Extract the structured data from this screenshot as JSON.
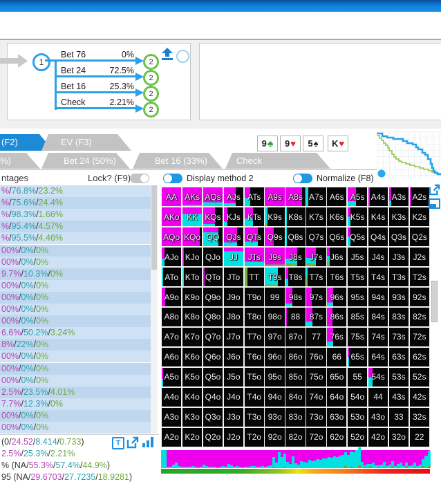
{
  "tree": {
    "root_node": "1",
    "branches": [
      {
        "label": "Bet 76",
        "freq": "0%",
        "node": "2"
      },
      {
        "label": "Bet 24",
        "freq": "72.5%",
        "node": "2"
      },
      {
        "label": "Bet 16",
        "freq": "25.3%",
        "node": "2"
      },
      {
        "label": "Check",
        "freq": "2.21%",
        "node": "2"
      }
    ]
  },
  "tabs_row1": [
    {
      "label": "(F2)",
      "active": true
    },
    {
      "label": "EV (F3)",
      "active": false
    }
  ],
  "tabs_row2": [
    {
      "label": "%)"
    },
    {
      "label": "Bet 24 (50%)"
    },
    {
      "label": "Bet 16 (33%)"
    },
    {
      "label": "Check"
    }
  ],
  "board_cards": [
    {
      "rank": "9",
      "suit": "♣",
      "color": "#2f9e2f",
      "gap_before": false
    },
    {
      "rank": "9",
      "suit": "♥",
      "color": "#e02828",
      "gap_before": false
    },
    {
      "rank": "5",
      "suit": "♠",
      "color": "#222222",
      "gap_before": false
    },
    {
      "rank": "K",
      "suit": "♥",
      "color": "#e02828",
      "gap_before": true
    }
  ],
  "left_panel": {
    "header": "ntages",
    "lock_label": "Lock? (F9)",
    "rows": [
      [
        "%",
        "76.8%",
        "23.2%"
      ],
      [
        "%",
        "75.6%",
        "24.4%"
      ],
      [
        "%",
        "98.3%",
        "1.66%"
      ],
      [
        "%",
        "95.4%",
        "4.57%"
      ],
      [
        "%",
        "95.5%",
        "4.46%"
      ],
      [
        "00%",
        "0%",
        "0%"
      ],
      [
        "00%",
        "0%",
        "0%"
      ],
      [
        "9.7%",
        "10.3%",
        "0%"
      ],
      [
        "00%",
        "0%",
        "0%"
      ],
      [
        "00%",
        "0%",
        "0%"
      ],
      [
        "00%",
        "0%",
        "0%"
      ],
      [
        "00%",
        "0%",
        "0%"
      ],
      [
        "6.6%",
        "50.2%",
        "3.24%"
      ],
      [
        "8%",
        "22%",
        "0%"
      ],
      [
        "00%",
        "0%",
        "0%"
      ],
      [
        "00%",
        "0%",
        "0%"
      ],
      [
        "00%",
        "0%",
        "0%"
      ],
      [
        "2.5%",
        "23.5%",
        "4.01%"
      ],
      [
        "7.7%",
        "12.3%",
        "0%"
      ],
      [
        "00%",
        "0%",
        "0%"
      ],
      [
        "00%",
        "0%",
        "0%"
      ]
    ]
  },
  "stats": {
    "lines": [
      [
        [
          "(0/",
          "d"
        ],
        [
          "24.52",
          "m"
        ],
        [
          "/",
          "d"
        ],
        [
          "8.414",
          "t"
        ],
        [
          "/",
          "d"
        ],
        [
          "0.733",
          "g"
        ],
        [
          ")",
          "d"
        ]
      ],
      [
        [
          "2.5%",
          "m"
        ],
        [
          "/",
          "d"
        ],
        [
          "25.3%",
          "t"
        ],
        [
          "/",
          "d"
        ],
        [
          "2.21%",
          "g"
        ]
      ],
      [
        [
          "% (NA/",
          "d"
        ],
        [
          "55.3%",
          "m"
        ],
        [
          "/",
          "d"
        ],
        [
          "57.4%",
          "t"
        ],
        [
          "/",
          "d"
        ],
        [
          "44.9%",
          "g"
        ],
        [
          ")",
          "d"
        ]
      ],
      [
        [
          "95 (NA/",
          "d"
        ],
        [
          "29.6703",
          "m"
        ],
        [
          "/",
          "d"
        ],
        [
          "27.7235",
          "t"
        ],
        [
          "/",
          "d"
        ],
        [
          "18.9281",
          "g"
        ],
        [
          ")",
          "d"
        ]
      ]
    ],
    "t_button": "T"
  },
  "toggles": {
    "display_method": "Display method 2",
    "normalize": "Normalize (F8)"
  },
  "matrix": {
    "ranks": [
      "A",
      "K",
      "Q",
      "J",
      "T",
      "9",
      "8",
      "7",
      "6",
      "5",
      "4",
      "3",
      "2"
    ],
    "action_colors": {
      "magenta": "#ee00ee",
      "cyan": "#00e2e2",
      "green": "#76b043",
      "none": "#060606"
    },
    "cells": [
      [
        [
          1,
          1,
          0,
          0
        ],
        [
          1,
          0.95,
          0.05,
          0
        ],
        [
          1,
          0.8,
          0.2,
          0
        ],
        [
          0.6,
          0.85,
          0.15,
          0
        ],
        [
          0.3,
          0.55,
          0.45,
          0
        ],
        [
          1,
          1,
          0,
          0
        ],
        [
          0.85,
          1,
          0,
          0
        ],
        [
          0.1,
          0,
          1,
          0
        ],
        [
          0
        ],
        [
          0.42,
          0.75,
          0.25,
          0
        ],
        [
          0.08,
          1,
          0,
          0
        ],
        [
          0.1,
          0.7,
          0.3,
          0
        ],
        [
          0.08,
          1,
          0,
          0
        ]
      ],
      [
        [
          1,
          1,
          0,
          0
        ],
        [
          1,
          0.35,
          0.65,
          0
        ],
        [
          0.62,
          0.88,
          0.12,
          0
        ],
        [
          0.2,
          0.75,
          0.25,
          0
        ],
        [
          0.45,
          0.6,
          0.4,
          0
        ],
        [
          0.12,
          0,
          0.85,
          0.15
        ],
        [
          0.06,
          0,
          1,
          0
        ],
        [
          0
        ],
        [
          0
        ],
        [
          0.15,
          0.5,
          0.5,
          0
        ],
        [
          0
        ],
        [
          0
        ],
        [
          0
        ]
      ],
      [
        [
          1,
          1,
          0,
          0
        ],
        [
          0.9,
          1,
          0,
          0
        ],
        [
          0.8,
          0.25,
          0.75,
          0
        ],
        [
          0.68,
          0.8,
          0.2,
          0
        ],
        [
          0.7,
          0.75,
          0.25,
          0
        ],
        [
          0.45,
          1,
          0,
          0
        ],
        [
          0.07,
          0,
          1,
          0
        ],
        [
          0
        ],
        [
          0
        ],
        [
          0.15,
          0.5,
          0.5,
          0
        ],
        [
          0
        ],
        [
          0
        ],
        [
          0
        ]
      ],
      [
        [
          0.15,
          0.6,
          0.4,
          0
        ],
        [
          0.08,
          1,
          0,
          0
        ],
        [
          0
        ],
        [
          1,
          0.2,
          0.8,
          0
        ],
        [
          1,
          0.75,
          0.25,
          0
        ],
        [
          1,
          0.9,
          0,
          0.1
        ],
        [
          0.6,
          0.6,
          0.25,
          0.15
        ],
        [
          0.5,
          0.55,
          0.3,
          0.15
        ],
        [
          0.15,
          0.45,
          0.35,
          0.2
        ],
        [
          0
        ],
        [
          0
        ],
        [
          0
        ],
        [
          0
        ]
      ],
      [
        [
          0.08,
          0,
          1,
          0
        ],
        [
          0.08,
          0,
          1,
          0
        ],
        [
          0.07,
          1,
          0,
          0
        ],
        [
          0
        ],
        [
          0.15,
          0,
          0,
          1
        ],
        [
          0.65,
          0,
          0.9,
          0.1
        ],
        [
          0.12,
          0.6,
          0.4,
          0
        ],
        [
          0.08,
          0,
          0.5,
          0.5
        ],
        [
          0
        ],
        [
          0
        ],
        [
          0
        ],
        [
          0
        ],
        [
          0
        ]
      ],
      [
        [
          0.18,
          1,
          0,
          0
        ],
        [
          0
        ],
        [
          0
        ],
        [
          0
        ],
        [
          0
        ],
        [
          0
        ],
        [
          0.35,
          0.85,
          0.15,
          0
        ],
        [
          0.28,
          1,
          0,
          0
        ],
        [
          0.33,
          0.8,
          0.2,
          0
        ],
        [
          0
        ],
        [
          0
        ],
        [
          0
        ],
        [
          0
        ]
      ],
      [
        [
          0
        ],
        [
          0
        ],
        [
          0
        ],
        [
          0
        ],
        [
          0
        ],
        [
          0
        ],
        [
          0.06,
          1,
          0,
          0
        ],
        [
          0.3,
          0.75,
          0.25,
          0
        ],
        [
          0.27,
          1,
          0,
          0
        ],
        [
          0
        ],
        [
          0
        ],
        [
          0
        ],
        [
          0
        ]
      ],
      [
        [
          0
        ],
        [
          0
        ],
        [
          0
        ],
        [
          0
        ],
        [
          0
        ],
        [
          0
        ],
        [
          0
        ],
        [
          0
        ],
        [
          0.3,
          0.75,
          0.25,
          0
        ],
        [
          0
        ],
        [
          0
        ],
        [
          0
        ],
        [
          0
        ]
      ],
      [
        [
          0
        ],
        [
          0
        ],
        [
          0
        ],
        [
          0
        ],
        [
          0
        ],
        [
          0
        ],
        [
          0
        ],
        [
          0
        ],
        [
          0
        ],
        [
          0.07,
          0.5,
          0.5,
          0
        ],
        [
          0
        ],
        [
          0
        ],
        [
          0
        ]
      ],
      [
        [
          0.07,
          0.6,
          0.4,
          0
        ],
        [
          0
        ],
        [
          0
        ],
        [
          0
        ],
        [
          0
        ],
        [
          0
        ],
        [
          0
        ],
        [
          0
        ],
        [
          0
        ],
        [
          0
        ],
        [
          0.2,
          0.5,
          0.5,
          0
        ],
        [
          0
        ],
        [
          0
        ]
      ],
      [
        [
          0
        ],
        [
          0
        ],
        [
          0
        ],
        [
          0
        ],
        [
          0
        ],
        [
          0
        ],
        [
          0
        ],
        [
          0
        ],
        [
          0
        ],
        [
          0
        ],
        [
          0
        ],
        [
          0
        ],
        [
          0
        ]
      ],
      [
        [
          0
        ],
        [
          0
        ],
        [
          0
        ],
        [
          0
        ],
        [
          0
        ],
        [
          0
        ],
        [
          0
        ],
        [
          0
        ],
        [
          0
        ],
        [
          0
        ],
        [
          0
        ],
        [
          0
        ],
        [
          0
        ]
      ],
      [
        [
          0
        ],
        [
          0
        ],
        [
          0
        ],
        [
          0
        ],
        [
          0
        ],
        [
          0
        ],
        [
          0
        ],
        [
          0
        ],
        [
          0
        ],
        [
          0
        ],
        [
          0
        ],
        [
          0
        ],
        [
          0
        ]
      ]
    ]
  },
  "histogram": {
    "cyan": [
      100,
      100,
      8,
      6,
      18,
      30,
      12,
      8,
      6,
      6,
      8,
      10,
      6,
      5,
      8,
      20,
      12,
      6,
      6,
      8,
      5,
      6,
      10,
      8,
      25,
      14,
      8,
      10,
      6,
      5,
      6,
      8,
      10,
      12,
      8,
      6,
      10,
      8,
      12,
      15,
      55,
      30,
      90,
      60,
      75,
      35,
      25,
      65,
      28,
      20,
      40,
      35,
      30,
      45,
      38,
      42,
      50,
      48,
      55,
      52,
      60,
      58,
      65,
      62,
      70,
      72,
      78,
      75,
      85,
      90,
      100,
      100,
      35,
      10,
      22,
      12,
      30,
      15,
      8,
      20,
      28,
      12,
      18,
      25,
      10,
      15,
      30,
      12,
      22,
      10,
      15,
      25,
      12,
      18,
      40,
      70,
      85
    ],
    "green": [
      0,
      0,
      0,
      0,
      0,
      0,
      0,
      0,
      0,
      0,
      0,
      0,
      0,
      0,
      0,
      0,
      0,
      0,
      0,
      0,
      0,
      0,
      0,
      0,
      0,
      0,
      0,
      0,
      0,
      0,
      0,
      0,
      0,
      0,
      0,
      0,
      0,
      0,
      0,
      0,
      8,
      0,
      0,
      0,
      6,
      0,
      0,
      0,
      0,
      0,
      0,
      0,
      0,
      0,
      0,
      0,
      0,
      0,
      0,
      0,
      0,
      0,
      0,
      0,
      0,
      0,
      10,
      0,
      8,
      0,
      0,
      14,
      0,
      6,
      0,
      10,
      0,
      0,
      8,
      0,
      6,
      0,
      0,
      12,
      0,
      8,
      0,
      0,
      10,
      0,
      0,
      6,
      0,
      0,
      12,
      0,
      10
    ]
  },
  "gradient_stops": [
    "#29a329 0%",
    "#35ab29 30%",
    "#8fc625 44%",
    "#e8e413 51%",
    "#f5a91d 57%",
    "#f4731d 70%",
    "#ee2222 84%",
    "#e80f0f 100%"
  ],
  "equity_graph": {
    "blue": [
      [
        0,
        3
      ],
      [
        8,
        3
      ],
      [
        8,
        7
      ],
      [
        15,
        7
      ],
      [
        15,
        9
      ],
      [
        24,
        9
      ],
      [
        24,
        11
      ],
      [
        38,
        11
      ],
      [
        38,
        14
      ],
      [
        44,
        14
      ],
      [
        44,
        17
      ],
      [
        52,
        17
      ],
      [
        52,
        19
      ],
      [
        57,
        19
      ],
      [
        57,
        23
      ],
      [
        60,
        23
      ],
      [
        60,
        26
      ],
      [
        66,
        26
      ],
      [
        66,
        31
      ],
      [
        70,
        31
      ],
      [
        70,
        34
      ],
      [
        74,
        34
      ],
      [
        74,
        40
      ],
      [
        78,
        40
      ],
      [
        78,
        47
      ],
      [
        80,
        47
      ],
      [
        80,
        53
      ],
      [
        82,
        53
      ],
      [
        82,
        57
      ],
      [
        84,
        57
      ],
      [
        84,
        60
      ],
      [
        88,
        60
      ],
      [
        88,
        62
      ],
      [
        93,
        62
      ]
    ],
    "green": [
      [
        0,
        6
      ],
      [
        4,
        6
      ],
      [
        4,
        10
      ],
      [
        7,
        10
      ],
      [
        7,
        13
      ],
      [
        10,
        13
      ],
      [
        10,
        17
      ],
      [
        13,
        17
      ],
      [
        13,
        20
      ],
      [
        16,
        20
      ],
      [
        16,
        24
      ],
      [
        18,
        24
      ],
      [
        18,
        28
      ],
      [
        22,
        28
      ],
      [
        22,
        33
      ],
      [
        25,
        33
      ],
      [
        25,
        37
      ],
      [
        28,
        37
      ],
      [
        28,
        40
      ],
      [
        32,
        40
      ],
      [
        32,
        43
      ],
      [
        36,
        43
      ],
      [
        36,
        45
      ],
      [
        42,
        45
      ],
      [
        42,
        47
      ],
      [
        48,
        47
      ],
      [
        48,
        49
      ],
      [
        55,
        49
      ],
      [
        55,
        51
      ],
      [
        62,
        51
      ],
      [
        62,
        53
      ],
      [
        68,
        53
      ],
      [
        68,
        55
      ],
      [
        75,
        55
      ],
      [
        75,
        57
      ],
      [
        80,
        57
      ],
      [
        80,
        59
      ],
      [
        86,
        59
      ],
      [
        86,
        61
      ],
      [
        93,
        61
      ]
    ],
    "dot": [
      7,
      61
    ],
    "blue_color": "#29a3e6",
    "green_color": "#8cc63f",
    "dot_color": "#29abe8"
  },
  "palette": {
    "d": "#333333",
    "m": "#b344b3",
    "t": "#2e9fae",
    "g": "#6fa83f",
    "row_odd": "#cfe2f5",
    "row_even": "#bed7ef"
  }
}
